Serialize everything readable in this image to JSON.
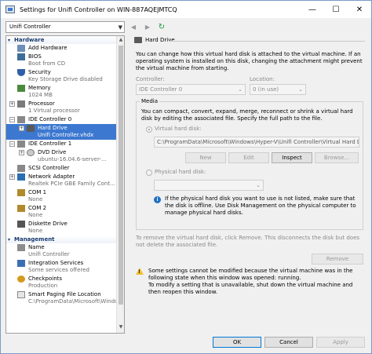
{
  "window": {
    "title": "Settings for Unifi Controller on WIN-887AQEJMTCQ",
    "buttons": {
      "minimize": "—",
      "maximize": "☐",
      "close": "✕"
    }
  },
  "toolbar": {
    "vm_selector": "Unifi Controller",
    "back": "◀",
    "forward": "▶",
    "refresh": "↻"
  },
  "sidebar": {
    "hardware_header": "Hardware",
    "management_header": "Management",
    "hardware_items": [
      {
        "name": "Add Hardware",
        "sub": ""
      },
      {
        "name": "BIOS",
        "sub": "Boot from CD"
      },
      {
        "name": "Security",
        "sub": "Key Storage Drive disabled"
      },
      {
        "name": "Memory",
        "sub": "1024 MB"
      },
      {
        "name": "Processor",
        "sub": "1 Virtual processor"
      },
      {
        "name": "IDE Controller 0",
        "sub": ""
      },
      {
        "name": "Hard Drive",
        "sub": "Unifi Controller.vhdx"
      },
      {
        "name": "IDE Controller 1",
        "sub": ""
      },
      {
        "name": "DVD Drive",
        "sub": "ubuntu-16.04.6-server-..."
      },
      {
        "name": "SCSI Controller",
        "sub": ""
      },
      {
        "name": "Network Adapter",
        "sub": "Realtek PCIe GBE Family Cont..."
      },
      {
        "name": "COM 1",
        "sub": "None"
      },
      {
        "name": "COM 2",
        "sub": "None"
      },
      {
        "name": "Diskette Drive",
        "sub": "None"
      }
    ],
    "management_items": [
      {
        "name": "Name",
        "sub": "Unifi Controller"
      },
      {
        "name": "Integration Services",
        "sub": "Some services offered"
      },
      {
        "name": "Checkpoints",
        "sub": "Production"
      },
      {
        "name": "Smart Paging File Location",
        "sub": "C:\\ProgramData\\Microsoft\\Windo..."
      }
    ]
  },
  "hard_drive": {
    "header": "Hard Drive",
    "intro": "You can change how this virtual hard disk is attached to the virtual machine. If an operating system is installed on this disk, changing the attachment might prevent the virtual machine from starting.",
    "controller_label": "Controller:",
    "controller_value": "IDE Controller 0",
    "location_label": "Location:",
    "location_value": "0 (in use)",
    "media_caption": "Media",
    "media_desc": "You can compact, convert, expand, merge, reconnect or shrink a virtual hard disk by editing the associated file. Specify the full path to the file.",
    "vhd_label": "Virtual hard disk:",
    "vhd_path": "C:\\ProgramData\\Microsoft\\Windows\\Hyper-V\\Unifi Controller\\Virtual Hard Disks",
    "btn_new": "New",
    "btn_edit": "Edit",
    "btn_inspect": "Inspect",
    "btn_browse": "Browse...",
    "phys_label": "Physical hard disk:",
    "phys_info": "If the physical hard disk you want to use is not listed, make sure that the disk is offline. Use Disk Management on the physical computer to manage physical hard disks.",
    "remove_text": "To remove the virtual hard disk, click Remove. This disconnects the disk but does not delete the associated file.",
    "btn_remove": "Remove",
    "warning": "Some settings cannot be modified because the virtual machine was in the following state when this window was opened: running.\nTo modify a setting that is unavailable, shut down the virtual machine and then reopen this window."
  },
  "footer": {
    "ok": "OK",
    "cancel": "Cancel",
    "apply": "Apply"
  },
  "colors": {
    "selection": "#3c78d0",
    "section_header": "#1a3a6e",
    "info": "#1f6fc5",
    "warning": "#f2c12e"
  }
}
